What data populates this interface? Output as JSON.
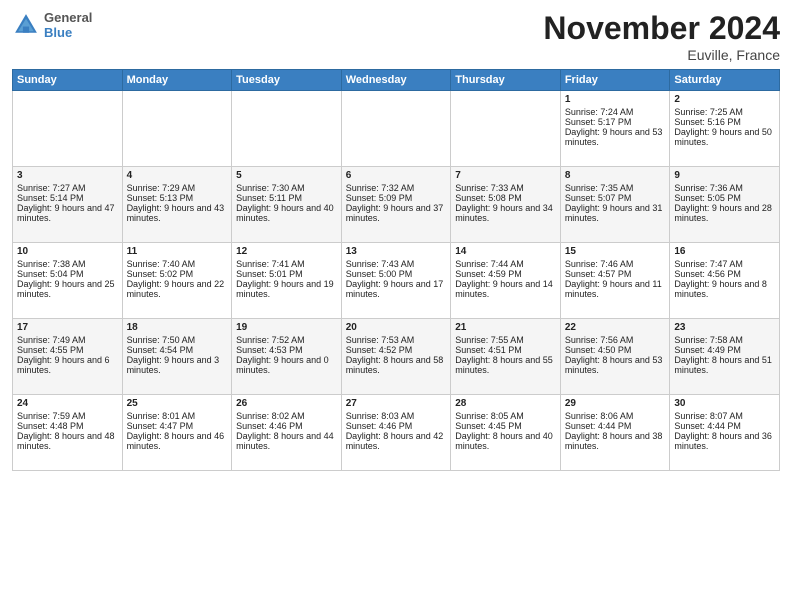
{
  "header": {
    "logo_general": "General",
    "logo_blue": "Blue",
    "title": "November 2024",
    "location": "Euville, France"
  },
  "weekdays": [
    "Sunday",
    "Monday",
    "Tuesday",
    "Wednesday",
    "Thursday",
    "Friday",
    "Saturday"
  ],
  "weeks": [
    [
      {
        "day": "",
        "content": ""
      },
      {
        "day": "",
        "content": ""
      },
      {
        "day": "",
        "content": ""
      },
      {
        "day": "",
        "content": ""
      },
      {
        "day": "",
        "content": ""
      },
      {
        "day": "1",
        "content": "Sunrise: 7:24 AM\nSunset: 5:17 PM\nDaylight: 9 hours and 53 minutes."
      },
      {
        "day": "2",
        "content": "Sunrise: 7:25 AM\nSunset: 5:16 PM\nDaylight: 9 hours and 50 minutes."
      }
    ],
    [
      {
        "day": "3",
        "content": "Sunrise: 7:27 AM\nSunset: 5:14 PM\nDaylight: 9 hours and 47 minutes."
      },
      {
        "day": "4",
        "content": "Sunrise: 7:29 AM\nSunset: 5:13 PM\nDaylight: 9 hours and 43 minutes."
      },
      {
        "day": "5",
        "content": "Sunrise: 7:30 AM\nSunset: 5:11 PM\nDaylight: 9 hours and 40 minutes."
      },
      {
        "day": "6",
        "content": "Sunrise: 7:32 AM\nSunset: 5:09 PM\nDaylight: 9 hours and 37 minutes."
      },
      {
        "day": "7",
        "content": "Sunrise: 7:33 AM\nSunset: 5:08 PM\nDaylight: 9 hours and 34 minutes."
      },
      {
        "day": "8",
        "content": "Sunrise: 7:35 AM\nSunset: 5:07 PM\nDaylight: 9 hours and 31 minutes."
      },
      {
        "day": "9",
        "content": "Sunrise: 7:36 AM\nSunset: 5:05 PM\nDaylight: 9 hours and 28 minutes."
      }
    ],
    [
      {
        "day": "10",
        "content": "Sunrise: 7:38 AM\nSunset: 5:04 PM\nDaylight: 9 hours and 25 minutes."
      },
      {
        "day": "11",
        "content": "Sunrise: 7:40 AM\nSunset: 5:02 PM\nDaylight: 9 hours and 22 minutes."
      },
      {
        "day": "12",
        "content": "Sunrise: 7:41 AM\nSunset: 5:01 PM\nDaylight: 9 hours and 19 minutes."
      },
      {
        "day": "13",
        "content": "Sunrise: 7:43 AM\nSunset: 5:00 PM\nDaylight: 9 hours and 17 minutes."
      },
      {
        "day": "14",
        "content": "Sunrise: 7:44 AM\nSunset: 4:59 PM\nDaylight: 9 hours and 14 minutes."
      },
      {
        "day": "15",
        "content": "Sunrise: 7:46 AM\nSunset: 4:57 PM\nDaylight: 9 hours and 11 minutes."
      },
      {
        "day": "16",
        "content": "Sunrise: 7:47 AM\nSunset: 4:56 PM\nDaylight: 9 hours and 8 minutes."
      }
    ],
    [
      {
        "day": "17",
        "content": "Sunrise: 7:49 AM\nSunset: 4:55 PM\nDaylight: 9 hours and 6 minutes."
      },
      {
        "day": "18",
        "content": "Sunrise: 7:50 AM\nSunset: 4:54 PM\nDaylight: 9 hours and 3 minutes."
      },
      {
        "day": "19",
        "content": "Sunrise: 7:52 AM\nSunset: 4:53 PM\nDaylight: 9 hours and 0 minutes."
      },
      {
        "day": "20",
        "content": "Sunrise: 7:53 AM\nSunset: 4:52 PM\nDaylight: 8 hours and 58 minutes."
      },
      {
        "day": "21",
        "content": "Sunrise: 7:55 AM\nSunset: 4:51 PM\nDaylight: 8 hours and 55 minutes."
      },
      {
        "day": "22",
        "content": "Sunrise: 7:56 AM\nSunset: 4:50 PM\nDaylight: 8 hours and 53 minutes."
      },
      {
        "day": "23",
        "content": "Sunrise: 7:58 AM\nSunset: 4:49 PM\nDaylight: 8 hours and 51 minutes."
      }
    ],
    [
      {
        "day": "24",
        "content": "Sunrise: 7:59 AM\nSunset: 4:48 PM\nDaylight: 8 hours and 48 minutes."
      },
      {
        "day": "25",
        "content": "Sunrise: 8:01 AM\nSunset: 4:47 PM\nDaylight: 8 hours and 46 minutes."
      },
      {
        "day": "26",
        "content": "Sunrise: 8:02 AM\nSunset: 4:46 PM\nDaylight: 8 hours and 44 minutes."
      },
      {
        "day": "27",
        "content": "Sunrise: 8:03 AM\nSunset: 4:46 PM\nDaylight: 8 hours and 42 minutes."
      },
      {
        "day": "28",
        "content": "Sunrise: 8:05 AM\nSunset: 4:45 PM\nDaylight: 8 hours and 40 minutes."
      },
      {
        "day": "29",
        "content": "Sunrise: 8:06 AM\nSunset: 4:44 PM\nDaylight: 8 hours and 38 minutes."
      },
      {
        "day": "30",
        "content": "Sunrise: 8:07 AM\nSunset: 4:44 PM\nDaylight: 8 hours and 36 minutes."
      }
    ]
  ]
}
